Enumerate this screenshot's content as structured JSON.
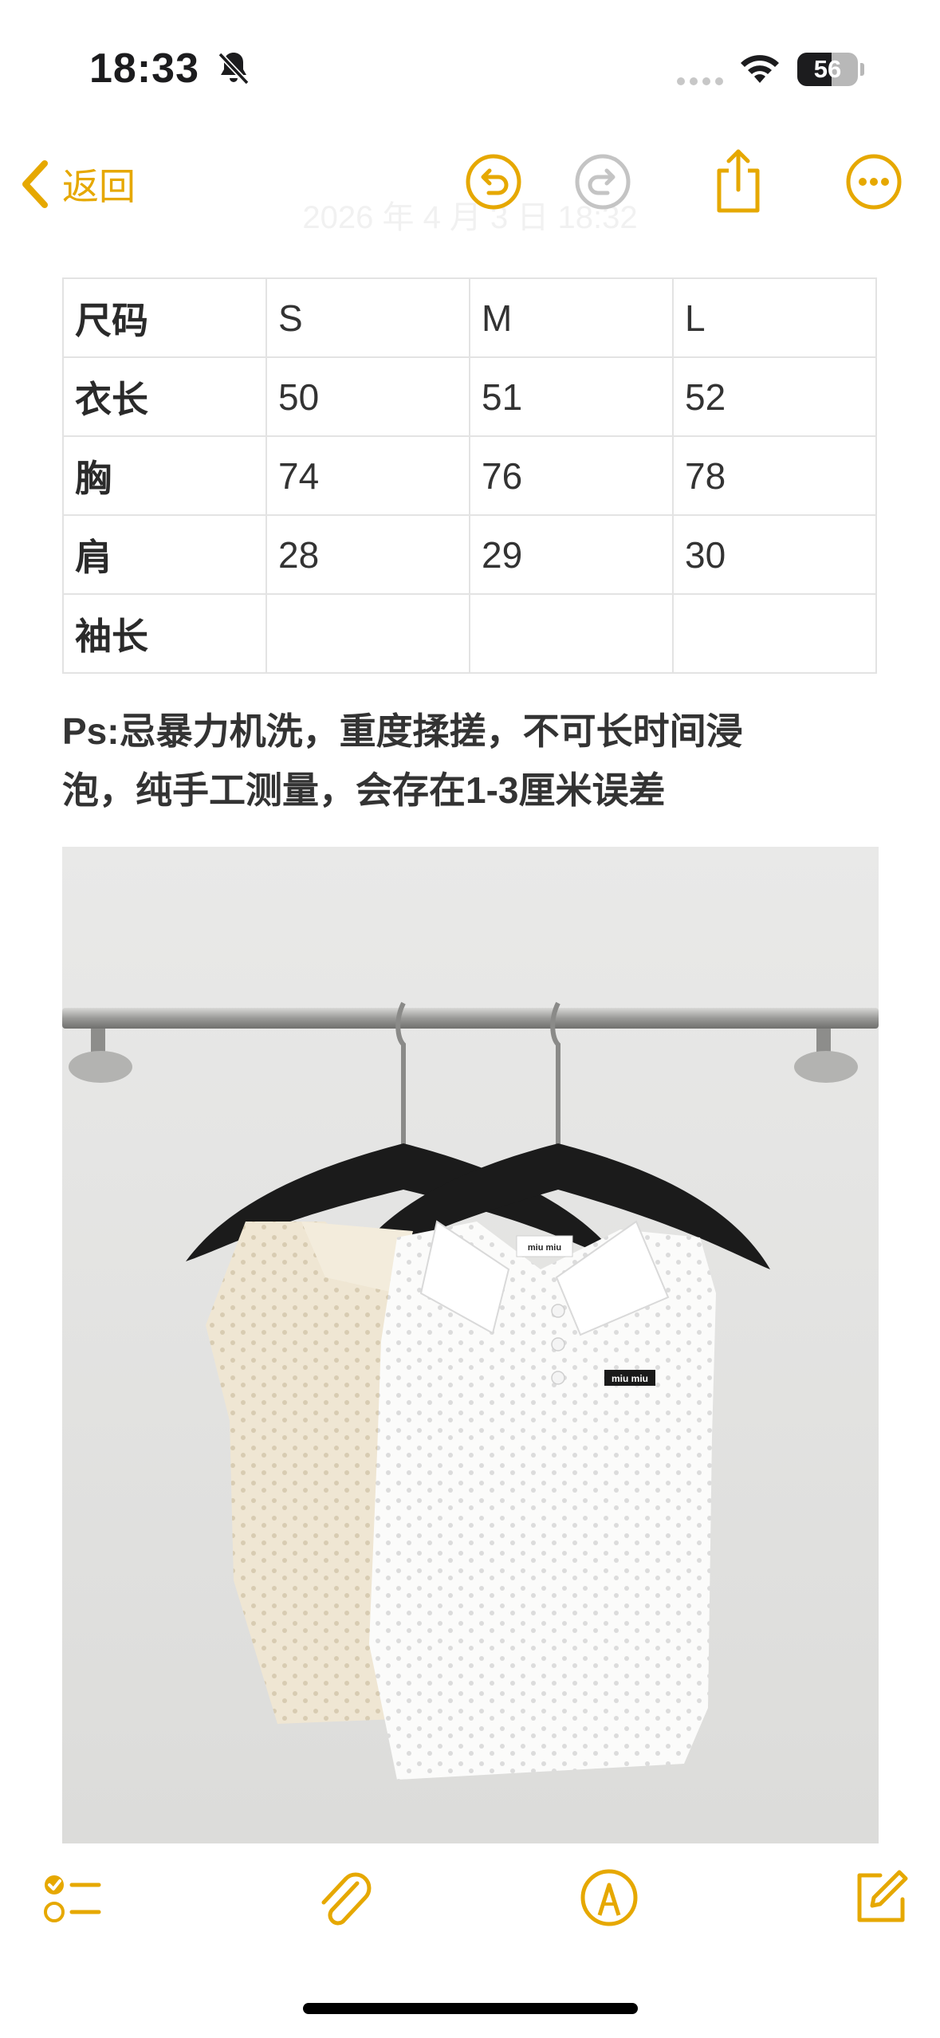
{
  "status_bar": {
    "time": "18:33",
    "battery": "56",
    "battery_level": 0.56
  },
  "nav": {
    "back_label": "返回",
    "date_ghost": "2026 年 4 月 3 日 18:32"
  },
  "size_table": {
    "rows": [
      [
        "尺码",
        "S",
        "M",
        "L"
      ],
      [
        "衣长",
        "50",
        "51",
        "52"
      ],
      [
        "胸",
        "74",
        "76",
        "78"
      ],
      [
        "肩",
        "28",
        "29",
        "30"
      ],
      [
        "袖长",
        "",
        "",
        ""
      ]
    ]
  },
  "note": {
    "line1": "Ps:忌暴力机洗，重度揉搓，不可长时间浸",
    "line2": "泡，纯手工测量，会存在1-3厘米误差"
  },
  "photo": {
    "label_text": "miu miu"
  },
  "colors": {
    "accent": "#e6a800",
    "disabled": "#c4c4c4"
  },
  "icons": {
    "back": "chevron-left-icon",
    "undo": "undo-icon",
    "redo": "redo-icon",
    "share": "share-icon",
    "more": "more-icon",
    "checklist": "checklist-icon",
    "attach": "paperclip-icon",
    "markup": "markup-pen-icon",
    "compose": "compose-icon"
  }
}
